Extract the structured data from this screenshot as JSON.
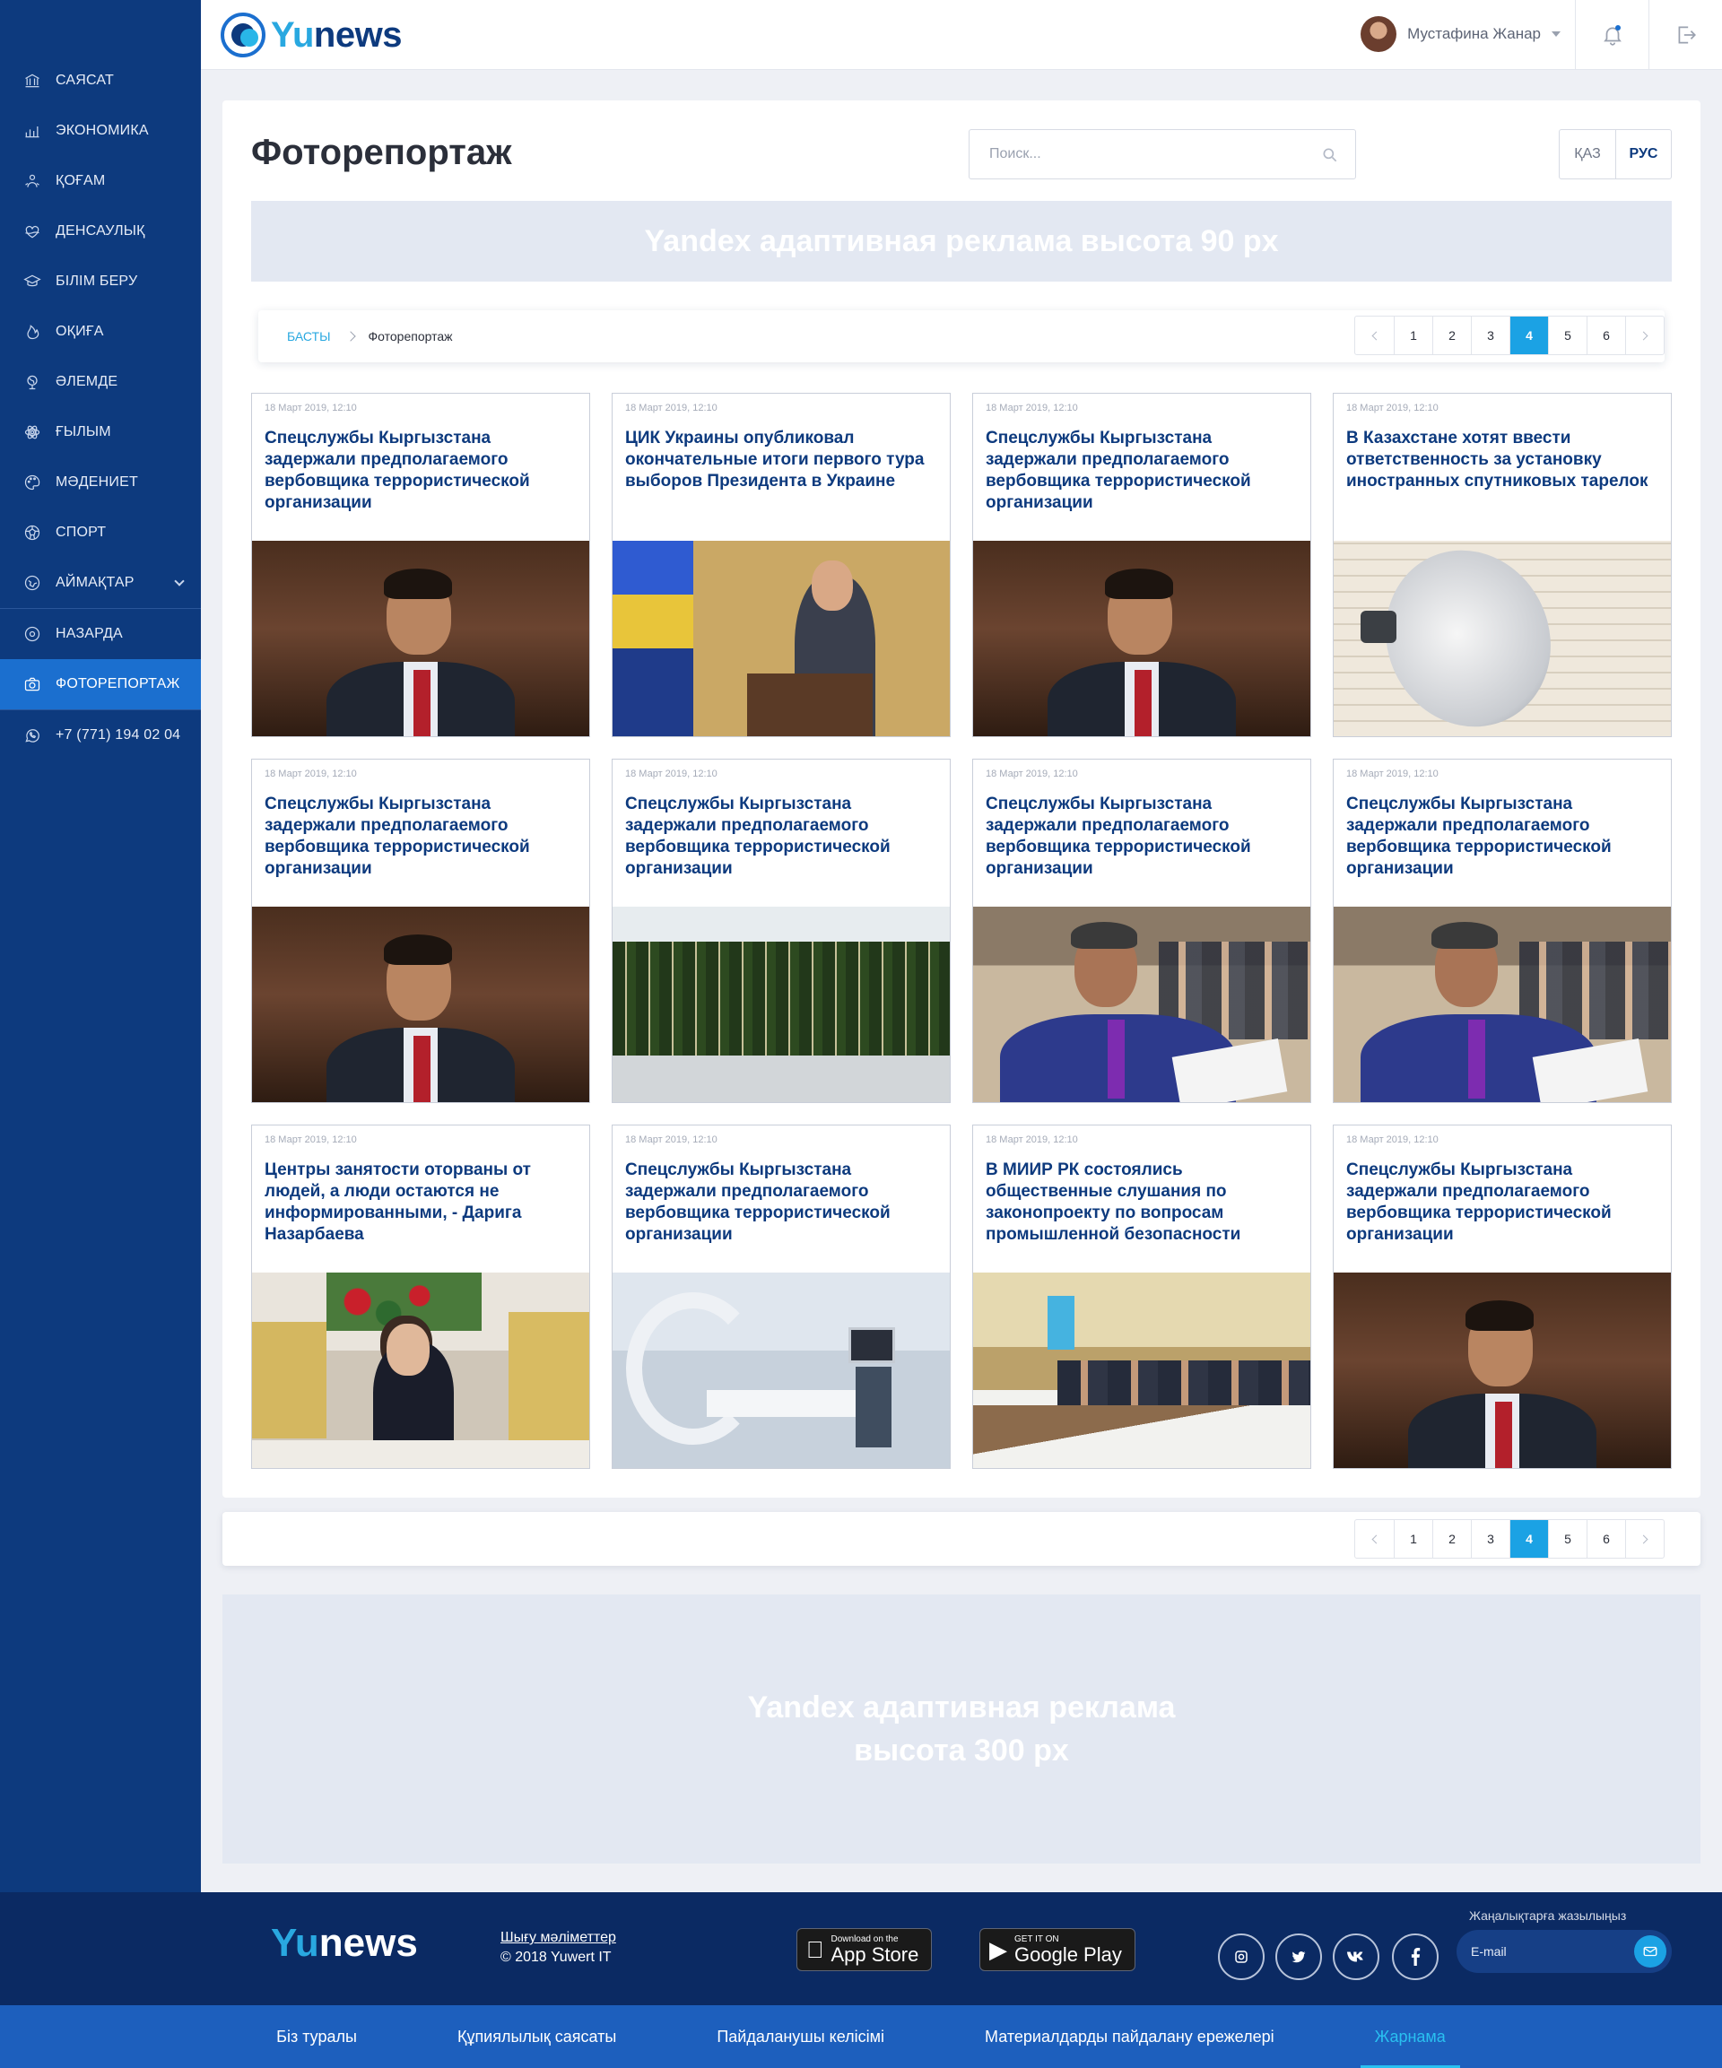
{
  "sidebar": {
    "items": [
      {
        "label": "Саясат",
        "icon": "bank-icon"
      },
      {
        "label": "Экономика",
        "icon": "chart-icon"
      },
      {
        "label": "Қоғам",
        "icon": "society-icon"
      },
      {
        "label": "Денсаулық",
        "icon": "health-icon"
      },
      {
        "label": "Білім беру",
        "icon": "education-icon"
      },
      {
        "label": "Оқиға",
        "icon": "fire-icon"
      },
      {
        "label": "Әлемде",
        "icon": "globe-icon"
      },
      {
        "label": "Ғылым",
        "icon": "atom-icon"
      },
      {
        "label": "Мәдениет",
        "icon": "palette-icon"
      },
      {
        "label": "Спорт",
        "icon": "ball-icon"
      },
      {
        "label": "Аймақтар",
        "icon": "map-icon"
      },
      {
        "label": "Назарда",
        "icon": "eye-icon"
      },
      {
        "label": "Фоторепортаж",
        "icon": "camera-icon"
      },
      {
        "label": "+7 (771) 194 02 04",
        "icon": "whatsapp-icon"
      }
    ],
    "active_index": 12
  },
  "header": {
    "logo_yu": "Yu",
    "logo_news": "news",
    "user_name": "Мустафина Жанар"
  },
  "page": {
    "title": "Фоторепортаж",
    "search_placeholder": "Поиск...",
    "lang": [
      "ҚАЗ",
      "РУС"
    ],
    "lang_active": "РУС",
    "ad_top": "Yandex адаптивная реклама высота 90 px",
    "ad_bottom": "Yandex адаптивная реклама высота 300 px"
  },
  "breadcrumb": {
    "home": "Басты",
    "current": "Фоторепортаж"
  },
  "pagination": {
    "pages": [
      "1",
      "2",
      "3",
      "4",
      "5",
      "6"
    ],
    "current": "4"
  },
  "cards": [
    {
      "date": "18 Март 2019, 12:10",
      "title": "Спецслужбы Кыргызстана задержали предполагаемого вербовщика террористической организации",
      "photo": "minister"
    },
    {
      "date": "18 Март 2019, 12:10",
      "title": "ЦИК Украины опубликовал окончательные итоги первого тура выборов Президента в Украине",
      "photo": "ukr"
    },
    {
      "date": "18 Март 2019, 12:10",
      "title": "Спецслужбы Кыргызстана задержали предполагаемого вербовщика террористической организации",
      "photo": "minister"
    },
    {
      "date": "18 Март 2019, 12:10",
      "title": "В Казахстане хотят ввести ответственность за установку иностранных спутниковых тарелок",
      "photo": "dish"
    },
    {
      "date": "18 Март 2019, 12:10",
      "title": "Спецслужбы Кыргызстана задержали предполагаемого вербовщика террористической организации",
      "photo": "minister"
    },
    {
      "date": "18 Март 2019, 12:10",
      "title": "Спецслужбы Кыргызстана задержали предполагаемого вербовщика террористической организации",
      "photo": "wine"
    },
    {
      "date": "18 Март 2019, 12:10",
      "title": "Спецслужбы Кыргызстана задержали предполагаемого вербовщика террористической организации",
      "photo": "deputy"
    },
    {
      "date": "18 Март 2019, 12:10",
      "title": "Спецслужбы Кыргызстана задержали предполагаемого вербовщика террористической организации",
      "photo": "deputy"
    },
    {
      "date": "18 Март 2019, 12:10",
      "title": "Центры занятости оторваны от людей, а люди остаются не информированными, - Дарига Назарбаева",
      "photo": "nazarbaeva"
    },
    {
      "date": "18 Март 2019, 12:10",
      "title": "Спецслужбы Кыргызстана задержали предполагаемого вербовщика террористической организации",
      "photo": "clinic"
    },
    {
      "date": "18 Март 2019, 12:10",
      "title": "В МИИР РК состоялись общественные слушания по законопроекту по вопросам промышленной безопасности",
      "photo": "meeting"
    },
    {
      "date": "18 Март 2019, 12:10",
      "title": "Спецслужбы Кыргызстана задержали предполагаемого вербовщика террористической организации",
      "photo": "minister"
    }
  ],
  "footer": {
    "logo_yu": "Yu",
    "logo_news": "news",
    "info_link": "Шығу мәліметтер",
    "copyright": "© 2018 Yuwert IT",
    "appstore_small": "Download on the",
    "appstore_big": "App Store",
    "googleplay_small": "GET IT ON",
    "googleplay_big": "Google Play",
    "social": [
      "instagram-icon",
      "twitter-icon",
      "vk-icon",
      "facebook-icon"
    ],
    "subscribe_label": "Жаңалықтарға жазылыңыз",
    "subscribe_placeholder": "E-mail",
    "nav": [
      "Біз туралы",
      "Құпиялылық саясаты",
      "Пайдаланушы келісімі",
      "Материалдарды пайдалану ережелері",
      "Жарнама"
    ],
    "nav_active": "Жарнама"
  }
}
